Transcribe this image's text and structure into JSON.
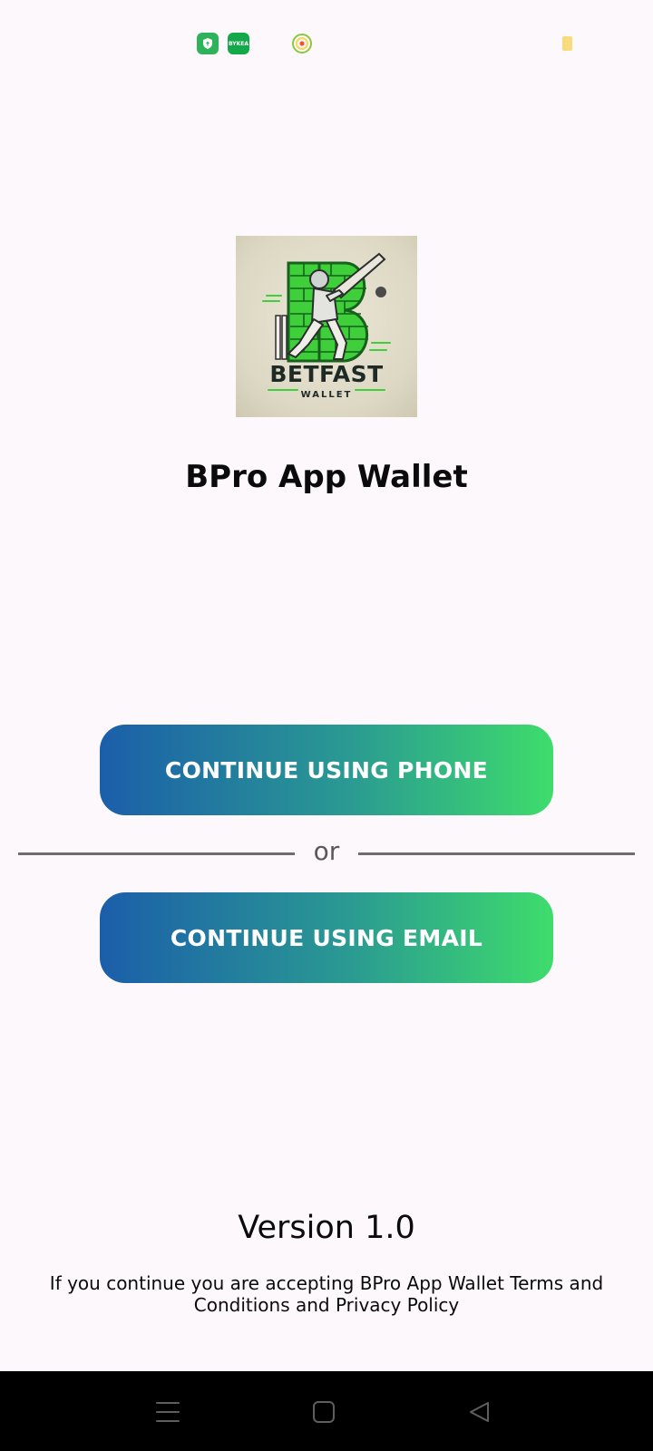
{
  "status_bar": {
    "icons": [
      "shield-app-icon",
      "byksa-app-icon",
      "target-app-icon",
      "battery-icon"
    ],
    "byksa_label": "BYKEA"
  },
  "logo": {
    "title": "BETFAST",
    "subtitle": "WALLET",
    "colors": {
      "brick": "#3fcf3a",
      "brick_dark": "#1b7a22",
      "ink": "#1d2a26",
      "background": "#e3dfcc"
    }
  },
  "app_name": "BPro App Wallet",
  "buttons": {
    "phone": "CONTINUE USING PHONE",
    "email": "CONTINUE USING EMAIL",
    "gradient": [
      "#1b5eaa",
      "#2a9a92",
      "#3edc6c"
    ]
  },
  "divider": {
    "label": "or"
  },
  "footer": {
    "version": "Version 1.0",
    "terms": "If you continue you are accepting BPro App Wallet Terms and Conditions and Privacy Policy"
  },
  "nav_bar": {
    "icons": [
      "menu-icon",
      "home-icon",
      "back-icon"
    ]
  }
}
